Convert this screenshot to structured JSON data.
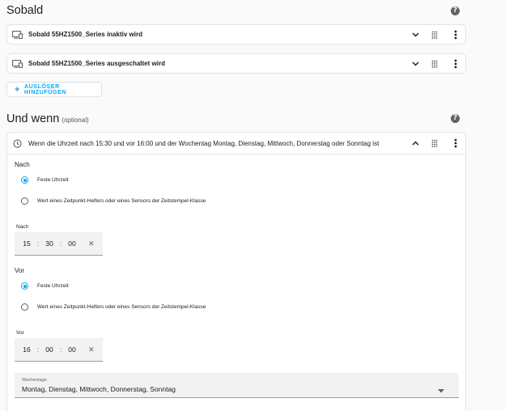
{
  "triggers": {
    "title": "Sobald",
    "help_icon": "?",
    "items": [
      {
        "label": "Sobald 55HZ1500_Series inaktiv wird",
        "icon": "device-icon"
      },
      {
        "label": "Sobald 55HZ1500_Series ausgeschaltet wird",
        "icon": "device-icon"
      }
    ],
    "add_button": {
      "plus": "+",
      "label": "AUSLÖSER HINZUFÜGEN"
    }
  },
  "conditions": {
    "title": "Und wenn",
    "optional": "(optional)",
    "help_icon": "?",
    "condition": {
      "label": "Wenn die Uhrzeit nach 15:30 und vor 16:00 und der Wochentag Montag, Dienstag, Mittwoch, Donnerstag oder Sonntag ist",
      "icon": "clock-icon",
      "after": {
        "section_label": "Nach",
        "option_fixed": "Feste Uhrzeit",
        "option_helper": "Wert eines Zeitpunkt-Helfers oder eines Sensors der Zeitstempel-Klasse",
        "selected": "fixed",
        "time_label": "Nach",
        "hours": "15",
        "minutes": "30",
        "seconds": "00",
        "separator": ":",
        "clear": "✕"
      },
      "before": {
        "section_label": "Vor",
        "option_fixed": "Feste Uhrzeit",
        "option_helper": "Wert eines Zeitpunkt-Helfers oder eines Sensors der Zeitstempel-Klasse",
        "selected": "fixed",
        "time_label": "Vor",
        "hours": "16",
        "minutes": "00",
        "seconds": "00",
        "separator": ":",
        "clear": "✕"
      },
      "weekdays": {
        "label": "Wochentage",
        "value": "Montag, Dienstag, Mittwoch, Donnerstag, Sonntag"
      }
    }
  },
  "colors": {
    "accent": "#03a9f4",
    "icon": "#5f6368"
  }
}
